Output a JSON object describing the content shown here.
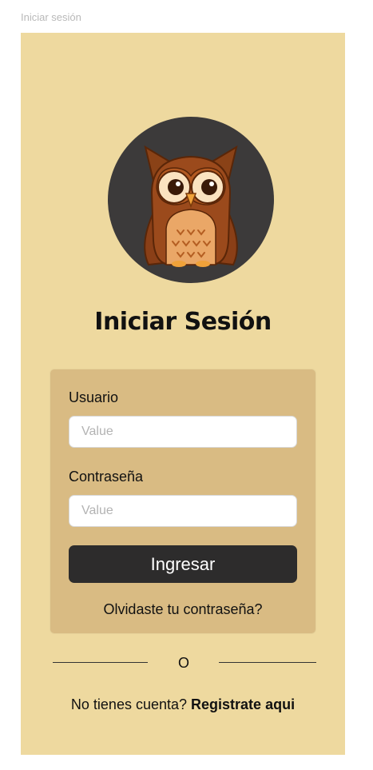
{
  "frame": {
    "label": "Iniciar sesión"
  },
  "header": {
    "title": "Iniciar Sesión"
  },
  "form": {
    "username_label": "Usuario",
    "username_placeholder": "Value",
    "password_label": "Contraseña",
    "password_placeholder": "Value",
    "submit_label": "Ingresar",
    "forgot_password": "Olvidaste tu contraseña?"
  },
  "divider": {
    "text": "O"
  },
  "footer": {
    "prompt": "No tienes cuenta?",
    "register_link": "Registrate aqui"
  },
  "icons": {
    "avatar": "owl-icon"
  },
  "colors": {
    "background": "#eed99f",
    "card": "#d9bb83",
    "button": "#2d2c2c",
    "avatar_bg": "#3c3a3a"
  }
}
